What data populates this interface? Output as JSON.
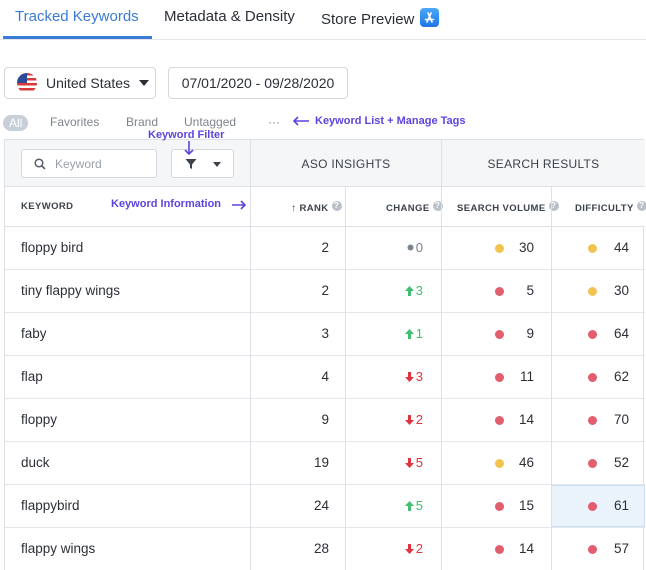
{
  "tabs": [
    {
      "label": "Tracked Keywords"
    },
    {
      "label": "Metadata & Density"
    },
    {
      "label": "Store Preview"
    }
  ],
  "country": {
    "label": "United States",
    "flag": "us-flag-icon"
  },
  "date_range": "07/01/2020 - 09/28/2020",
  "chips": {
    "all": "All",
    "favorites": "Favorites",
    "brand": "Brand",
    "untagged": "Untagged",
    "more": "···"
  },
  "annotations": {
    "keyword_list": "Keyword List + Manage Tags",
    "keyword_filter": "Keyword Filter",
    "keyword_information": "Keyword Information"
  },
  "search": {
    "placeholder": "Keyword"
  },
  "groups": {
    "aso_insights": "ASO INSIGHTS",
    "search_results": "SEARCH RESULTS"
  },
  "columns": {
    "keyword": "KEYWORD",
    "rank": "RANK",
    "change": "CHANGE",
    "search_volume": "SEARCH VOLUME",
    "difficulty": "DIFFICULTY"
  },
  "colors": {
    "accent": "#3a7bd5",
    "annotation": "#5b45e0",
    "dot_neutral": "#7a8490",
    "dot_yellow": "#f1c451",
    "dot_red": "#e25d6e",
    "up": "#3fbf6f",
    "down": "#e0353f"
  },
  "rows": [
    {
      "keyword": "floppy bird",
      "rank": "2",
      "change": "0",
      "change_dir": "none",
      "volume": "30",
      "volume_color": "yellow",
      "difficulty": "44",
      "difficulty_color": "yellow"
    },
    {
      "keyword": "tiny flappy wings",
      "rank": "2",
      "change": "3",
      "change_dir": "up",
      "volume": "5",
      "volume_color": "red",
      "difficulty": "30",
      "difficulty_color": "yellow"
    },
    {
      "keyword": "faby",
      "rank": "3",
      "change": "1",
      "change_dir": "up",
      "volume": "9",
      "volume_color": "red",
      "difficulty": "64",
      "difficulty_color": "red"
    },
    {
      "keyword": "flap",
      "rank": "4",
      "change": "3",
      "change_dir": "down",
      "volume": "11",
      "volume_color": "red",
      "difficulty": "62",
      "difficulty_color": "red"
    },
    {
      "keyword": "floppy",
      "rank": "9",
      "change": "2",
      "change_dir": "down",
      "volume": "14",
      "volume_color": "red",
      "difficulty": "70",
      "difficulty_color": "red"
    },
    {
      "keyword": "duck",
      "rank": "19",
      "change": "5",
      "change_dir": "down",
      "volume": "46",
      "volume_color": "yellow",
      "difficulty": "52",
      "difficulty_color": "red"
    },
    {
      "keyword": "flappybird",
      "rank": "24",
      "change": "5",
      "change_dir": "up",
      "volume": "15",
      "volume_color": "red",
      "difficulty": "61",
      "difficulty_color": "red",
      "highlight_difficulty": true
    },
    {
      "keyword": "flappy wings",
      "rank": "28",
      "change": "2",
      "change_dir": "down",
      "volume": "14",
      "volume_color": "red",
      "difficulty": "57",
      "difficulty_color": "red"
    }
  ]
}
